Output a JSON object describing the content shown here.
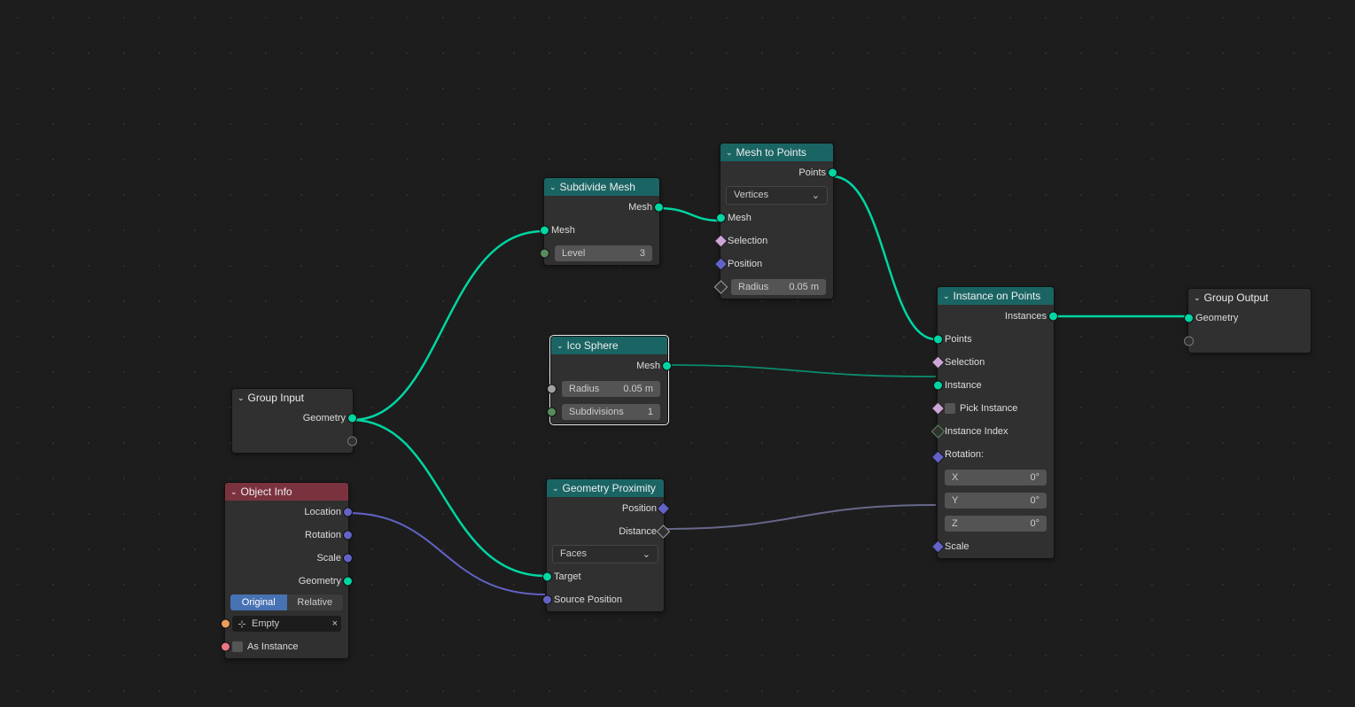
{
  "nodes": {
    "group_input": {
      "title": "Group Input",
      "outputs": [
        {
          "label": "Geometry"
        }
      ]
    },
    "object_info": {
      "title": "Object Info",
      "outputs": [
        "Location",
        "Rotation",
        "Scale",
        "Geometry"
      ],
      "toggle": [
        "Original",
        "Relative"
      ],
      "object": "Empty",
      "as_instance": "As Instance"
    },
    "subdivide": {
      "title": "Subdivide Mesh",
      "out": "Mesh",
      "mesh": "Mesh",
      "level_l": "Level",
      "level_v": "3"
    },
    "ico": {
      "title": "Ico Sphere",
      "out": "Mesh",
      "radius_l": "Radius",
      "radius_v": "0.05 m",
      "sub_l": "Subdivisions",
      "sub_v": "1"
    },
    "prox": {
      "title": "Geometry Proximity",
      "out1": "Position",
      "out2": "Distance",
      "drop": "Faces",
      "target": "Target",
      "src": "Source Position"
    },
    "m2p": {
      "title": "Mesh to Points",
      "out": "Points",
      "drop": "Vertices",
      "mesh": "Mesh",
      "sel": "Selection",
      "pos": "Position",
      "rad_l": "Radius",
      "rad_v": "0.05 m"
    },
    "iop": {
      "title": "Instance on Points",
      "out": "Instances",
      "points": "Points",
      "sel": "Selection",
      "inst": "Instance",
      "pick": "Pick Instance",
      "idx": "Instance Index",
      "rot": "Rotation:",
      "x": "X",
      "y": "Y",
      "z": "Z",
      "deg": "0°",
      "scale": "Scale"
    },
    "gout": {
      "title": "Group Output",
      "geo": "Geometry"
    }
  }
}
